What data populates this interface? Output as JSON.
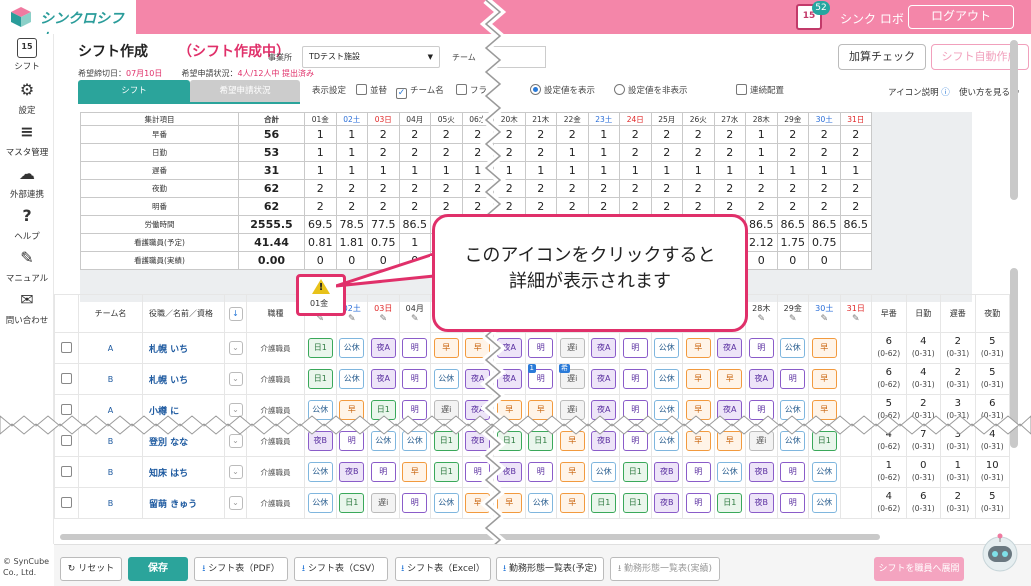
{
  "app": {
    "logo_text": "シンクロシフト"
  },
  "header": {
    "calendar_day": "15",
    "notification_count": "52",
    "user_name": "シンク ロボ",
    "logout_label": "ログアウト"
  },
  "sidebar": {
    "items": [
      {
        "label": "シフト",
        "icon": "calendar-icon",
        "glyph": "15"
      },
      {
        "label": "設定",
        "icon": "gear-icon",
        "glyph": "⚙"
      },
      {
        "label": "マスタ管理",
        "icon": "database-icon",
        "glyph": "≡"
      },
      {
        "label": "外部連携",
        "icon": "cloud-sync-icon",
        "glyph": "☁"
      },
      {
        "label": "ヘルプ",
        "icon": "help-icon",
        "glyph": "?"
      },
      {
        "label": "マニュアル",
        "icon": "manual-icon",
        "glyph": "✎"
      },
      {
        "label": "問い合わせ",
        "icon": "mail-icon",
        "glyph": "✉"
      }
    ]
  },
  "page": {
    "title": "シフト作成",
    "status": "（シフト作成中）",
    "deadline_label": "希望締切日：",
    "deadline_value": "07月10日",
    "hope_status_label": "希望申請状況：",
    "hope_status_value": "4人/12人中 提出済み",
    "facility_label": "事業所",
    "facility_value": "TDテスト施設",
    "team_label": "チーム",
    "kasan_button": "加算チェック",
    "auto_button": "シフト自動作成",
    "tab_shift": "シフト",
    "tab_hope": "希望申請状況",
    "display_settings_label": "表示設定",
    "opt_sort": "並替",
    "opt_teamname": "チーム名",
    "opt_flag": "フラ",
    "opt_show_values": "設定値を表示",
    "opt_hide_values": "設定値を非表示",
    "opt_continuous": "連続配置",
    "icon_help": "アイコン説明",
    "guide_link": "使い方を見る"
  },
  "summary": {
    "header_label": "集計項目",
    "total_label": "合計",
    "days": [
      {
        "label": "01金",
        "type": "normal"
      },
      {
        "label": "02土",
        "type": "sat"
      },
      {
        "label": "03日",
        "type": "sun"
      },
      {
        "label": "04月",
        "type": "normal"
      },
      {
        "label": "05火",
        "type": "normal"
      },
      {
        "label": "06水",
        "type": "normal"
      },
      {
        "label": "20木",
        "type": "normal"
      },
      {
        "label": "21木",
        "type": "normal"
      },
      {
        "label": "22金",
        "type": "normal"
      },
      {
        "label": "23土",
        "type": "sat"
      },
      {
        "label": "24日",
        "type": "sun"
      },
      {
        "label": "25月",
        "type": "normal"
      },
      {
        "label": "26火",
        "type": "normal"
      },
      {
        "label": "27水",
        "type": "normal"
      },
      {
        "label": "28木",
        "type": "normal"
      },
      {
        "label": "29金",
        "type": "normal"
      },
      {
        "label": "30土",
        "type": "sat"
      },
      {
        "label": "31日",
        "type": "sun"
      }
    ],
    "rows": [
      {
        "label": "早番",
        "total": "56",
        "values": [
          "1",
          "1",
          "2",
          "2",
          "2",
          "2",
          "2",
          "2",
          "2",
          "1",
          "2",
          "2",
          "2",
          "2",
          "1",
          "2",
          "2",
          "2"
        ]
      },
      {
        "label": "日勤",
        "total": "53",
        "values": [
          "1",
          "1",
          "2",
          "2",
          "2",
          "2",
          "2",
          "2",
          "1",
          "1",
          "2",
          "2",
          "2",
          "2",
          "1",
          "2",
          "2",
          "2"
        ]
      },
      {
        "label": "遅番",
        "total": "31",
        "values": [
          "1",
          "1",
          "1",
          "1",
          "1",
          "1",
          "1",
          "1",
          "1",
          "1",
          "1",
          "1",
          "1",
          "1",
          "1",
          "1",
          "1",
          "1"
        ]
      },
      {
        "label": "夜勤",
        "total": "62",
        "values": [
          "2",
          "2",
          "2",
          "2",
          "2",
          "2",
          "2",
          "2",
          "2",
          "2",
          "2",
          "2",
          "2",
          "2",
          "2",
          "2",
          "2",
          "2"
        ]
      },
      {
        "label": "明番",
        "total": "62",
        "values": [
          "2",
          "2",
          "2",
          "2",
          "2",
          "2",
          "2",
          "2",
          "2",
          "2",
          "2",
          "2",
          "2",
          "2",
          "2",
          "2",
          "2",
          "2"
        ]
      },
      {
        "label": "労働時間",
        "total": "2555.5",
        "values": [
          "69.5",
          "78.5",
          "77.5",
          "86.5",
          "",
          "",
          "",
          "",
          "",
          "",
          "",
          "",
          "",
          "77.5",
          "86.5",
          "86.5",
          "86.5",
          "86.5"
        ]
      },
      {
        "label": "看護職員(予定)",
        "total": "41.44",
        "values": [
          "0.81",
          "1.81",
          "0.75",
          "1",
          "",
          "",
          "",
          "",
          "",
          "",
          "",
          "",
          "",
          "1.12",
          "2.12",
          "1.75",
          "0.75",
          ""
        ]
      },
      {
        "label": "看護職員(実績)",
        "total": "0.00",
        "values": [
          "0",
          "0",
          "0",
          "0",
          "",
          "",
          "",
          "",
          "",
          "",
          "",
          "",
          "",
          "0",
          "0",
          "0",
          "0",
          ""
        ]
      }
    ]
  },
  "grid": {
    "headers": {
      "team": "チーム名",
      "role": "役職／名前／資格",
      "job": "職種"
    },
    "day_labels": [
      "01金",
      "02土",
      "03日",
      "04月",
      "05火",
      "06水",
      "20木",
      "21木",
      "22金",
      "23土",
      "24日",
      "25月",
      "26火",
      "27水",
      "28木",
      "29金",
      "30土",
      "31日"
    ],
    "stat_headers": [
      "早番",
      "日勤",
      "遅番",
      "夜勤"
    ],
    "rows": [
      {
        "team": "A",
        "name": "札幌 いち",
        "job": "介護職員",
        "shifts": [
          "日1",
          "公休",
          "夜A",
          "明",
          "早",
          "早",
          "夜A",
          "明",
          "遅i",
          "夜A",
          "明",
          "公休",
          "早",
          "夜A",
          "明",
          "公休",
          "早",
          ""
        ],
        "stats": [
          [
            "6",
            "(0-62)"
          ],
          [
            "4",
            "(0-31)"
          ],
          [
            "2",
            "(0-31)"
          ],
          [
            "5",
            "(0-31)"
          ]
        ]
      },
      {
        "team": "B",
        "name": "札幌 いち",
        "job": "介護職員",
        "shifts": [
          "日1",
          "公休",
          "夜A",
          "明",
          "公休",
          "夜A",
          "夜A",
          "明",
          "遅i",
          "夜A",
          "明",
          "公休",
          "早",
          "早",
          "夜A",
          "明",
          "早",
          ""
        ],
        "stats": [
          [
            "6",
            "(0-62)"
          ],
          [
            "4",
            "(0-31)"
          ],
          [
            "2",
            "(0-31)"
          ],
          [
            "5",
            "(0-31)"
          ]
        ]
      },
      {
        "team": "A",
        "name": "小樽 に",
        "job": "介護職員",
        "shifts": [
          "公休",
          "早",
          "日1",
          "明",
          "遅i",
          "夜A",
          "早",
          "早",
          "遅i",
          "夜A",
          "明",
          "公休",
          "早",
          "夜A",
          "明",
          "公休",
          "早",
          ""
        ],
        "stats": [
          [
            "5",
            "(0-62)"
          ],
          [
            "2",
            "(0-31)"
          ],
          [
            "3",
            "(0-31)"
          ],
          [
            "6",
            "(0-31)"
          ]
        ]
      },
      {
        "team": "B",
        "name": "登別 なな",
        "job": "介護職員",
        "shifts": [
          "夜B",
          "明",
          "公休",
          "公休",
          "日1",
          "夜B",
          "日1",
          "日1",
          "早",
          "夜B",
          "明",
          "公休",
          "早",
          "早",
          "遅i",
          "公休",
          "日1",
          ""
        ],
        "stats": [
          [
            "4",
            "(0-62)"
          ],
          [
            "7",
            "(0-31)"
          ],
          [
            "3",
            "(0-31)"
          ],
          [
            "4",
            "(0-31)"
          ]
        ]
      },
      {
        "team": "B",
        "name": "知床 はち",
        "job": "介護職員",
        "shifts": [
          "公休",
          "夜B",
          "明",
          "早",
          "日1",
          "明",
          "夜B",
          "明",
          "早",
          "公休",
          "日1",
          "夜B",
          "明",
          "公休",
          "夜B",
          "明",
          "公休",
          ""
        ],
        "stats": [
          [
            "1",
            "(0-62)"
          ],
          [
            "0",
            "(0-31)"
          ],
          [
            "1",
            "(0-31)"
          ],
          [
            "10",
            "(0-31)"
          ]
        ]
      },
      {
        "team": "B",
        "name": "留萌 きゅう",
        "job": "介護職員",
        "shifts": [
          "公休",
          "日1",
          "遅i",
          "明",
          "公休",
          "早",
          "早",
          "公休",
          "早",
          "日1",
          "日1",
          "夜B",
          "明",
          "日1",
          "夜B",
          "明",
          "公休",
          ""
        ],
        "stats": [
          [
            "4",
            "(0-62)"
          ],
          [
            "6",
            "(0-31)"
          ],
          [
            "2",
            "(0-31)"
          ],
          [
            "5",
            "(0-31)"
          ]
        ]
      }
    ],
    "badge_number": "1",
    "badge_hope": "希"
  },
  "warning": {
    "day": "01金"
  },
  "callout": {
    "line1": "このアイコンをクリックすると",
    "line2": "詳細が表示されます"
  },
  "bottom": {
    "reset": "リセット",
    "save": "保存",
    "pdf": "シフト表（PDF）",
    "csv": "シフト表（CSV）",
    "excel": "シフト表（Excel）",
    "pattern_plan": "勤務形態一覧表(予定)",
    "pattern_actual": "勤務形態一覧表(実績)",
    "deploy": "シフトを職員へ展開"
  },
  "copyright": {
    "line1": "© SynCube",
    "line2": "Co., Ltd."
  }
}
